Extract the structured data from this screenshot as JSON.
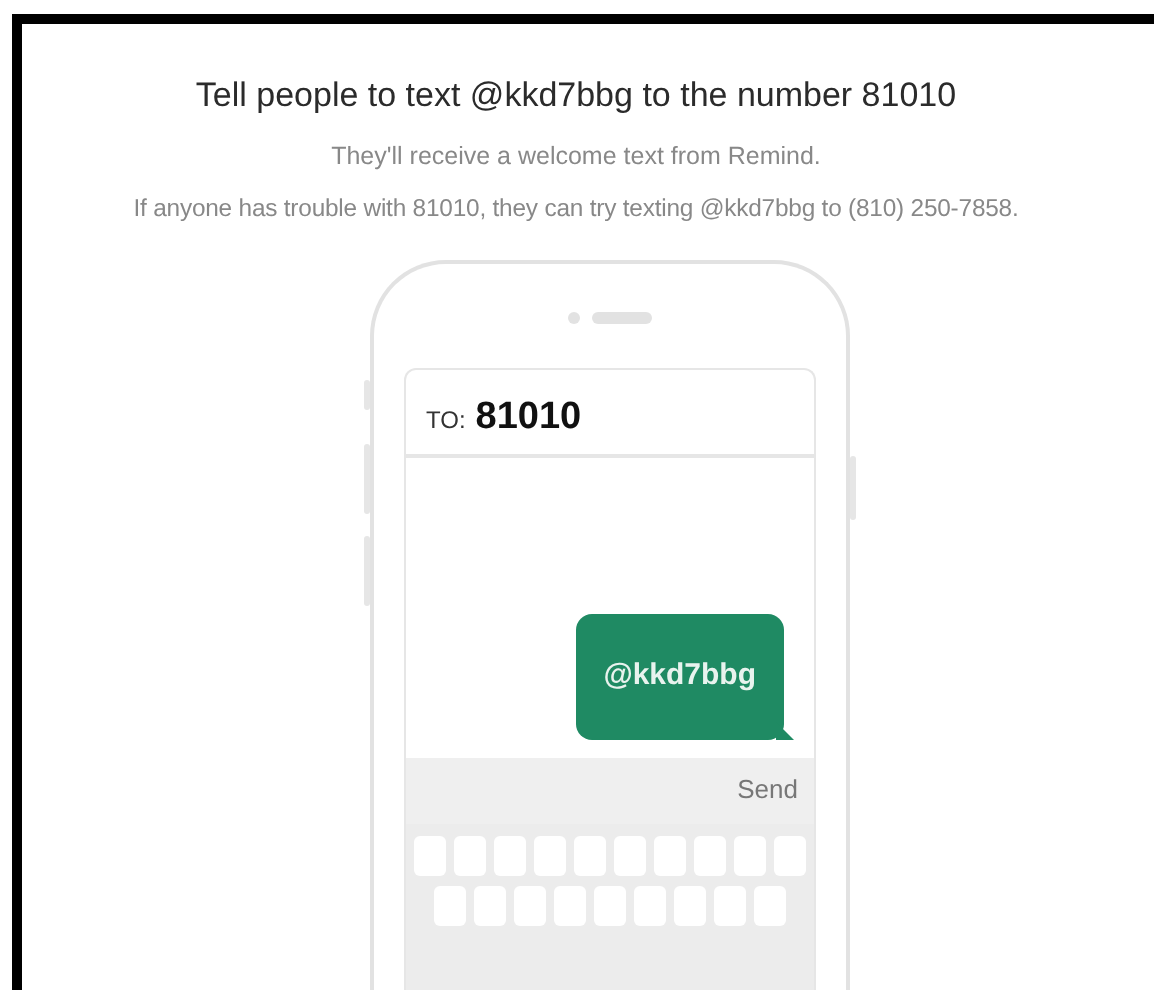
{
  "heading": "Tell people to text @kkd7bbg to the number 81010",
  "lines": [
    "They'll receive a welcome text from Remind.",
    "If anyone has trouble with 81010, they can try texting @kkd7bbg to (810) 250-7858."
  ],
  "phone": {
    "to_label": "TO:",
    "to_number": "81010",
    "message": "@kkd7bbg",
    "send_label": "Send"
  }
}
